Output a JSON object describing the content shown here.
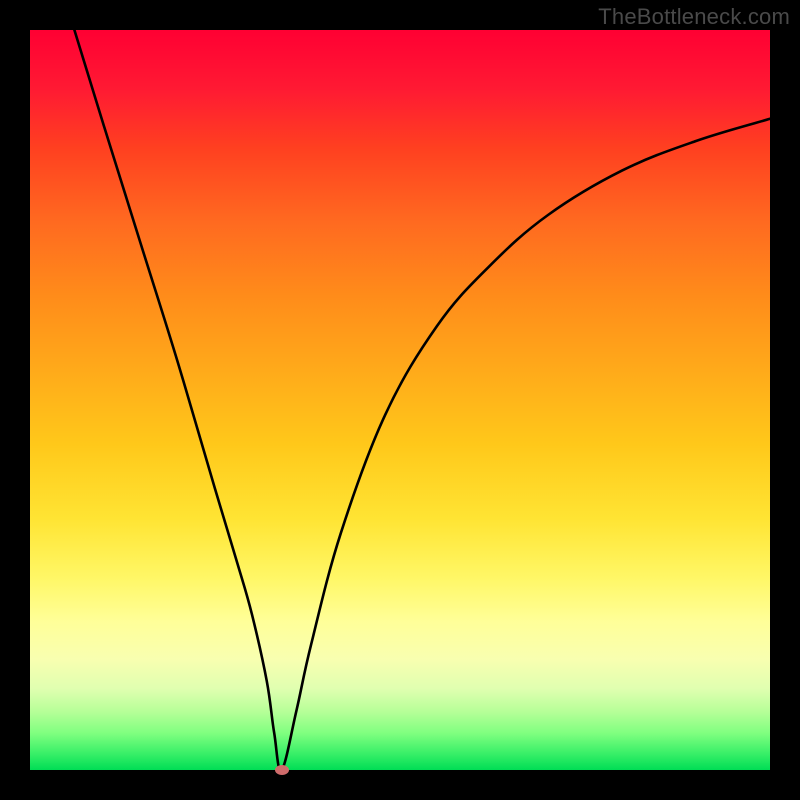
{
  "watermark": "TheBottleneck.com",
  "colors": {
    "top": "#ff0033",
    "mid": "#ffd020",
    "bottom": "#00dd55",
    "curve": "#000000",
    "dot": "#cf6b6b",
    "frame_bg": "#000000"
  },
  "chart_data": {
    "type": "line",
    "title": "",
    "xlabel": "",
    "ylabel": "",
    "xlim": [
      0,
      100
    ],
    "ylim": [
      0,
      100
    ],
    "series": [
      {
        "name": "bottleneck-curve",
        "x": [
          6,
          10,
          15,
          20,
          25,
          28,
          30,
          32,
          33,
          34,
          36,
          38,
          42,
          48,
          55,
          62,
          70,
          80,
          90,
          100
        ],
        "y": [
          100,
          87,
          71,
          55,
          38,
          28,
          21,
          12,
          5,
          0,
          8,
          17,
          32,
          48,
          60,
          68,
          75,
          81,
          85,
          88
        ]
      }
    ],
    "annotations": [
      {
        "name": "min-point-dot",
        "x": 34,
        "y": 0
      }
    ]
  }
}
